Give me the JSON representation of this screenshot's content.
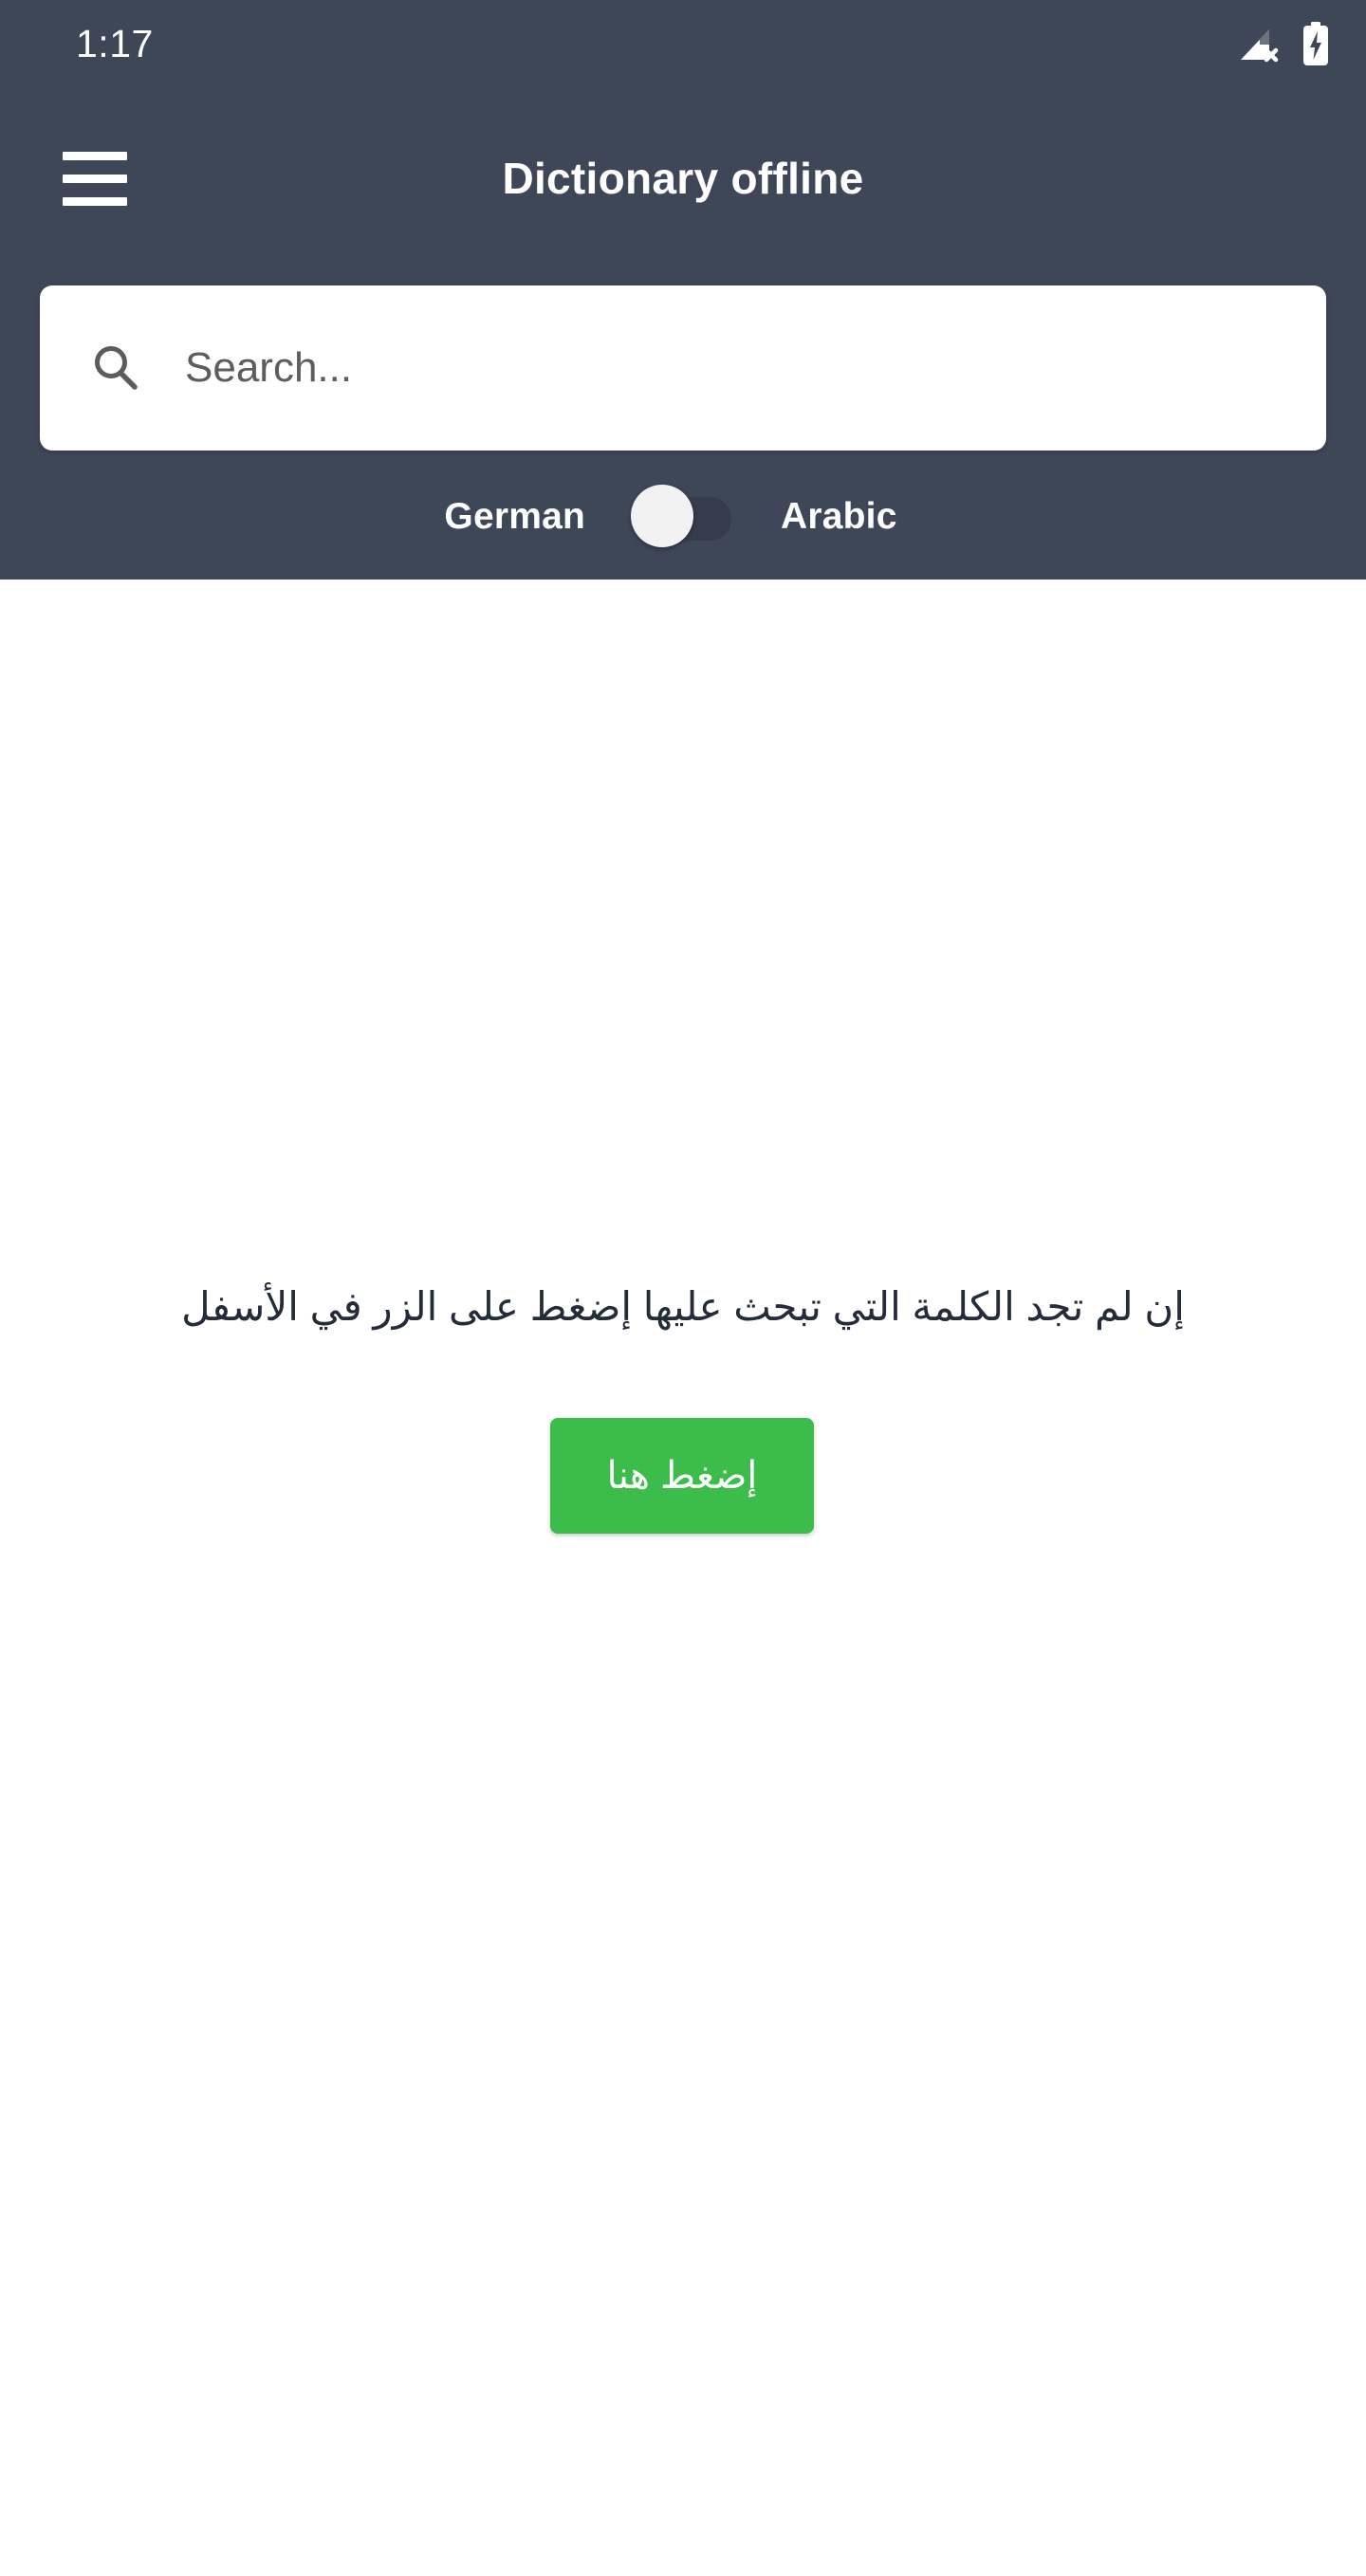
{
  "status_bar": {
    "time": "1:17",
    "icons": [
      {
        "name": "cellular-signal-off-icon",
        "label": "no signal"
      },
      {
        "name": "battery-charging-icon",
        "label": "charging"
      }
    ]
  },
  "appbar": {
    "menu_icon": "hamburger-menu-icon",
    "title": "Dictionary offline"
  },
  "search": {
    "icon": "search-icon",
    "placeholder": "Search...",
    "value": ""
  },
  "language_toggle": {
    "left_label": "German",
    "right_label": "Arabic",
    "state": "left",
    "knob_color": "#f2f2f2",
    "track_color": "#353d4d"
  },
  "content": {
    "empty_message": "إن لم تجد الكلمة التي تبحث عليها إضغط على الزر في الأسفل",
    "action_button_label": "إضغط هنا"
  },
  "colors": {
    "header_background": "#3e4757",
    "page_background": "#ffffff",
    "accent_green": "#3cbd4b",
    "text_primary": "#232c38",
    "text_on_dark": "#ffffff",
    "placeholder": "#5d5d5d"
  }
}
